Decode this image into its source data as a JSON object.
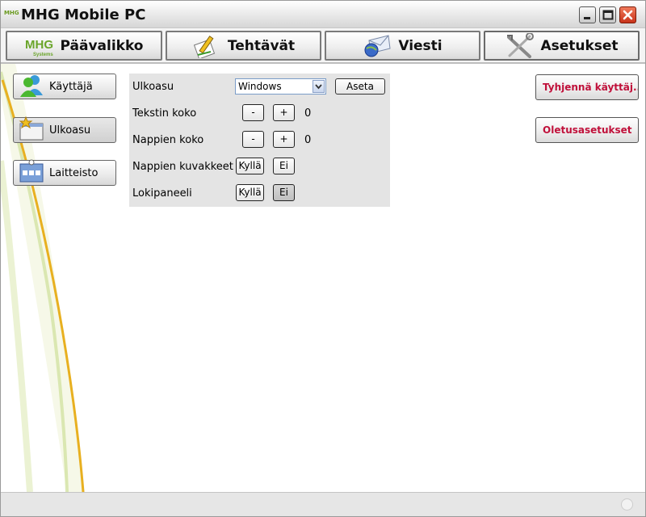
{
  "window": {
    "title": "MHG Mobile PC",
    "logo_text": "MHG"
  },
  "tabs": [
    {
      "label": "Päävalikko",
      "icon": "mhg-logo-icon"
    },
    {
      "label": "Tehtävät",
      "icon": "notepad-pencil-icon"
    },
    {
      "label": "Viesti",
      "icon": "envelope-globe-icon"
    },
    {
      "label": "Asetukset",
      "icon": "tools-icon",
      "active": true
    }
  ],
  "tab_logo": {
    "text": "MHG",
    "subtext": "Systems"
  },
  "sidebar": {
    "items": [
      {
        "label": "Käyttäjä",
        "icon": "users-icon"
      },
      {
        "label": "Ulkoasu",
        "icon": "window-star-icon",
        "active": true
      },
      {
        "label": "Laitteisto",
        "icon": "devices-icon"
      }
    ]
  },
  "settings": {
    "appearance": {
      "label": "Ulkoasu",
      "selected": "Windows",
      "apply": "Aseta"
    },
    "text_size": {
      "label": "Tekstin koko",
      "minus": "-",
      "plus": "+",
      "value": "0"
    },
    "button_size": {
      "label": "Nappien koko",
      "minus": "-",
      "plus": "+",
      "value": "0"
    },
    "button_icons": {
      "label": "Nappien kuvakkeet",
      "yes": "Kyllä",
      "no": "Ei",
      "selected": "no"
    },
    "log_panel": {
      "label": "Lokipaneeli",
      "yes": "Kyllä",
      "no": "Ei",
      "selected": "no"
    }
  },
  "actions": {
    "clear_users": "Tyhjennä käyttäj...",
    "defaults": "Oletusasetukset"
  },
  "colors": {
    "accent_red": "#c0103a",
    "logo_green": "#6aa52a",
    "swoosh_yellow": "#e8b020"
  }
}
